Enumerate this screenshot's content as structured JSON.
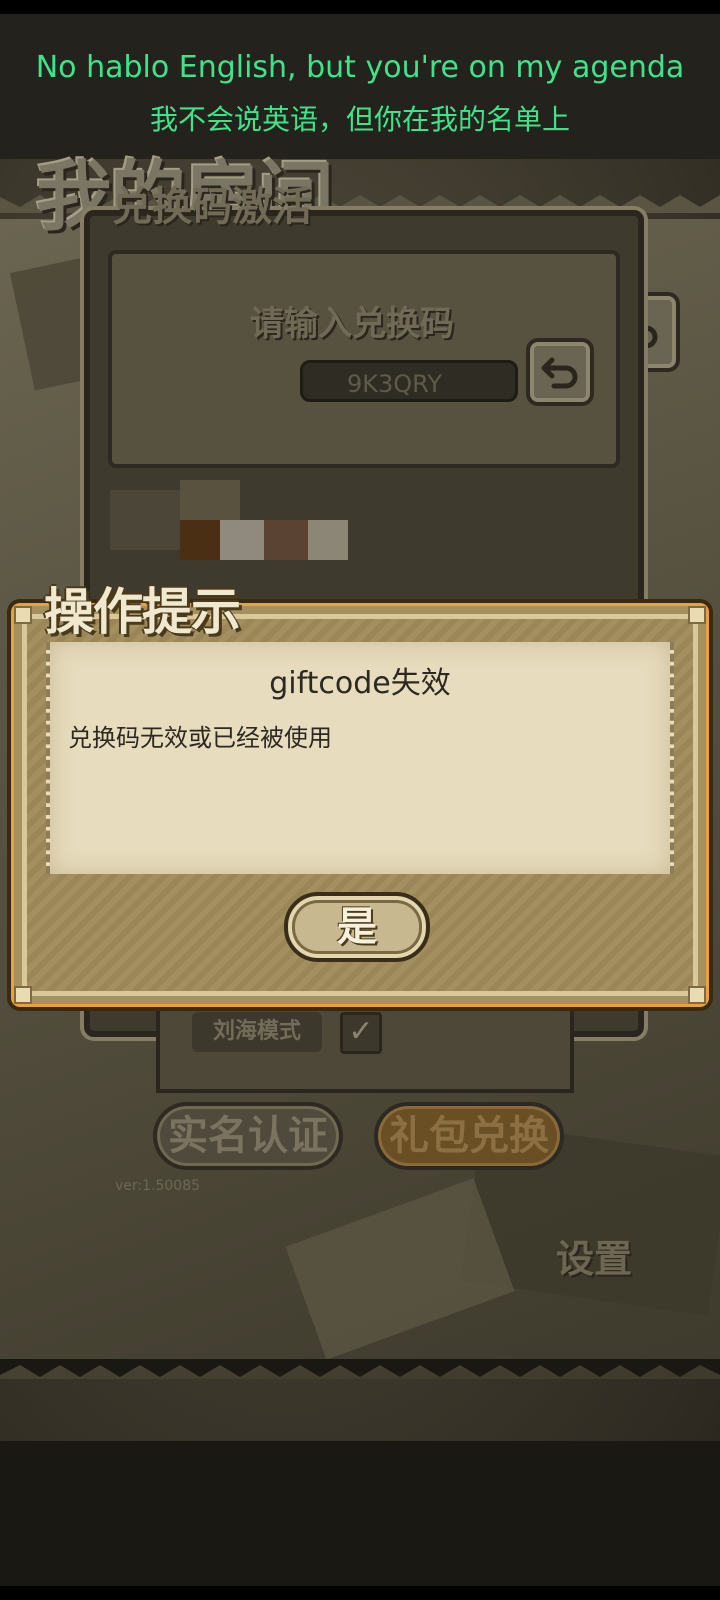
{
  "lyrics": {
    "line_en": "No hablo English, but you're on my agenda",
    "line_zh": "我不会说英语，但你在我的名单上"
  },
  "background_screen": {
    "title": "我的房间",
    "redeem_panel": {
      "title": "兑换码激活",
      "prompt": "请输入兑换码",
      "code_value": "9K3QRY"
    },
    "notch_mode_label": "刘海模式",
    "notch_mode_checked": true,
    "realname_button": "实名认证",
    "gift_button": "礼包兑换",
    "version": "ver:1.50085",
    "settings_label": "设置"
  },
  "dialog": {
    "header": "操作提示",
    "message_title": "giftcode失效",
    "message_body": "兑换码无效或已经被使用",
    "confirm_label": "是"
  },
  "colors": {
    "lyric_text": "#3ee38a",
    "dialog_paper": "#e7dcbd",
    "dialog_border_accent": "#e8a040"
  },
  "icons": [
    "back-arrow-icon",
    "checkmark-icon"
  ]
}
